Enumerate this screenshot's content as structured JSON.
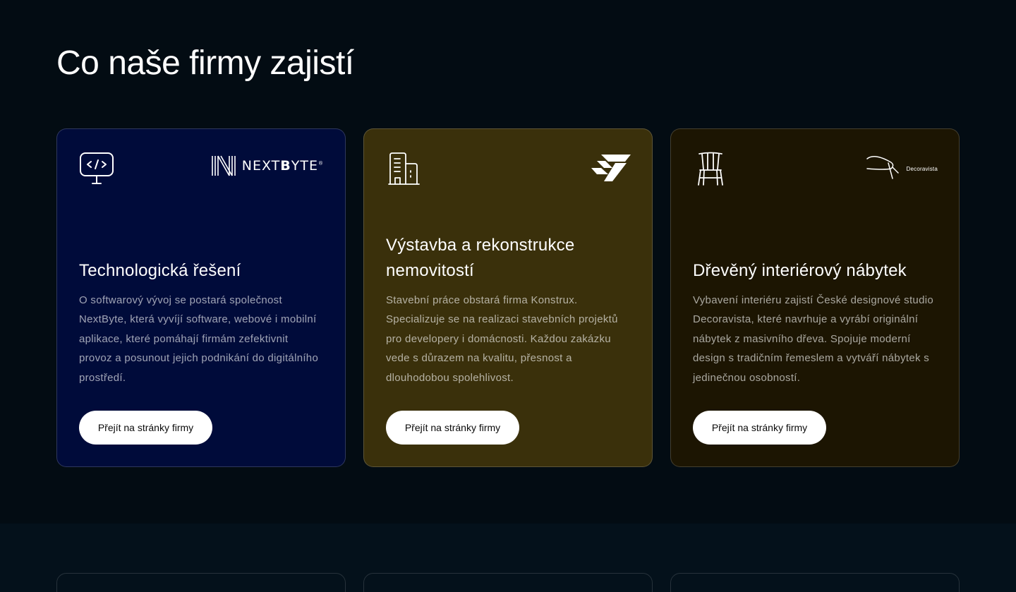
{
  "section": {
    "title": "Co naše firmy zajistí"
  },
  "cards": [
    {
      "icon": "monitor-code-icon",
      "brand": {
        "name": "NEXTBYTE",
        "name_part1": "NEXT",
        "name_part2": "B",
        "name_part3": "YTE",
        "mark": "®"
      },
      "title": "Technologická řešení",
      "text": "O softwarový vývoj se postará společnost NextByte, která vyvíjí software, webové i mobilní aplikace, které pomáhají firmám zefektivnit provoz a posunout jejich podnikání do digitálního prostředí.",
      "button": "Přejít na stránky firmy",
      "bg": "#000b3a"
    },
    {
      "icon": "buildings-icon",
      "brand": {
        "name": "Konstrux"
      },
      "title": "Výstavba a rekonstrukce nemovitostí",
      "text": "Stavební práce obstará firma Konstrux. Specializuje se na realizaci stavebních projektů pro developery i domácnosti. Každou zakázku vede s důrazem na kvalitu, přesnost a dlouhodobou spolehlivost.",
      "button": "Přejít na stránky firmy",
      "bg": "#3a300b"
    },
    {
      "icon": "chair-icon",
      "brand": {
        "name": "Decoravista"
      },
      "title": "Dřevěný interiérový nábytek",
      "text": "Vybavení interiéru zajistí České designové studio Decoravista, které navrhuje a vyrábí originální nábytek z masivního dřeva. Spojuje moderní design s tradičním řemeslem a vytváří nábytek s jedinečnou osobností.",
      "button": "Přejít na stránky firmy",
      "bg": "#1c1502"
    }
  ]
}
